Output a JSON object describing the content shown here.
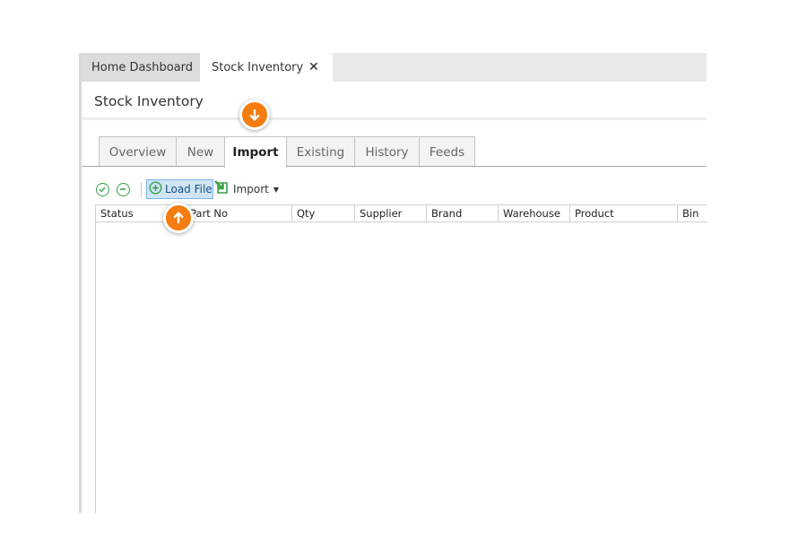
{
  "doc_tabs": [
    {
      "label": "Home Dashboard"
    },
    {
      "label": "Stock Inventory"
    }
  ],
  "page_title": "Stock Inventory",
  "tabs": [
    {
      "label": "Overview"
    },
    {
      "label": "New"
    },
    {
      "label": "Import"
    },
    {
      "label": "Existing"
    },
    {
      "label": "History"
    },
    {
      "label": "Feeds"
    }
  ],
  "active_tab": "Import",
  "toolbar": {
    "load_file_label": "Load File",
    "import_label": "Import"
  },
  "grid": {
    "columns": [
      "Status",
      "Part No",
      "Qty",
      "Supplier",
      "Brand",
      "Warehouse",
      "Product",
      "Bin"
    ],
    "rows": []
  },
  "colors": {
    "accent": "#f47c10",
    "green_icon": "#34a046",
    "selected_button": "#cfe5f7"
  },
  "icons": [
    "close-icon",
    "check-circle-icon",
    "minus-circle-icon",
    "plus-circle-icon",
    "import-arrow-icon",
    "caret-down-icon",
    "arrow-down-icon",
    "arrow-up-icon"
  ]
}
